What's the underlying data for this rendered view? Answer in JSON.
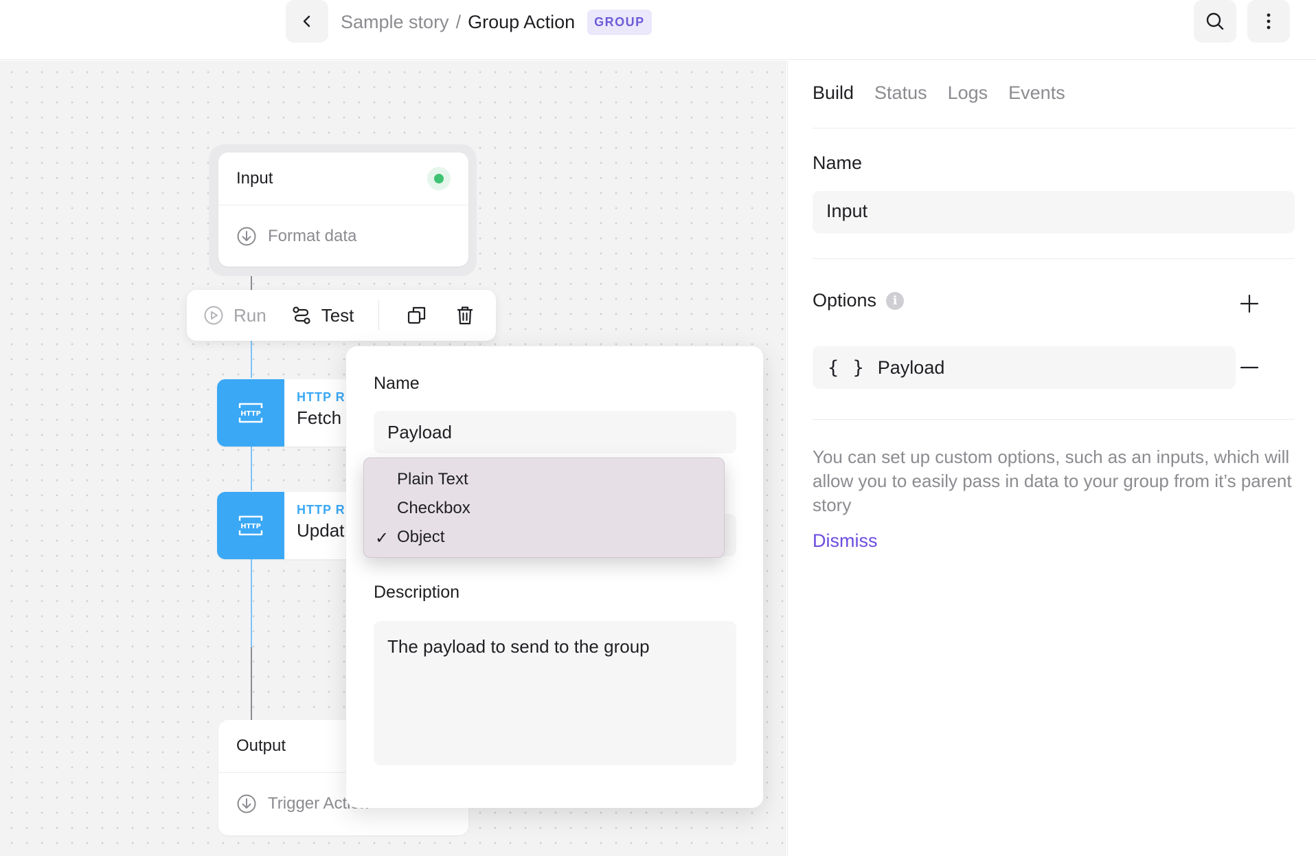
{
  "header": {
    "back_icon": "chevron-left-icon",
    "breadcrumb_parent": "Sample story",
    "breadcrumb_separator": "/",
    "breadcrumb_current": "Group Action",
    "badge": "GROUP",
    "search_icon": "search-icon",
    "more_icon": "more-vertical-icon"
  },
  "canvas": {
    "input_node": {
      "title": "Input",
      "subtitle": "Format data",
      "status": "active"
    },
    "toolbar": {
      "run_label": "Run",
      "test_label": "Test"
    },
    "http_nodes": [
      {
        "type": "HTTP R",
        "name": "Fetch"
      },
      {
        "type": "HTTP R",
        "name": "Updat"
      }
    ],
    "output_node": {
      "title": "Output",
      "subtitle": "Trigger Action"
    }
  },
  "popover": {
    "name_label": "Name",
    "name_value": "Payload",
    "description_label": "Description",
    "description_value": "The payload to send to the group",
    "type_options": [
      {
        "label": "Plain Text",
        "selected": false
      },
      {
        "label": "Checkbox",
        "selected": false
      },
      {
        "label": "Object",
        "selected": true
      }
    ],
    "check_glyph": "✓"
  },
  "panel": {
    "tabs": [
      {
        "label": "Build",
        "active": true
      },
      {
        "label": "Status",
        "active": false
      },
      {
        "label": "Logs",
        "active": false
      },
      {
        "label": "Events",
        "active": false
      }
    ],
    "name_label": "Name",
    "name_value": "Input",
    "options_label": "Options",
    "info_glyph": "i",
    "option_item": {
      "icon": "{ }",
      "name": "Payload"
    },
    "help_text": "You can set up custom options, such as an inputs, which will allow you to easily pass in data to your group from it’s parent story",
    "dismiss_label": "Dismiss"
  },
  "colors": {
    "accent": "#6c4ce0",
    "badge_bg": "#ebe8fb",
    "http_blue": "#3aa8f5",
    "status_green": "#3fc373",
    "canvas_bg": "#f3f3f4"
  }
}
